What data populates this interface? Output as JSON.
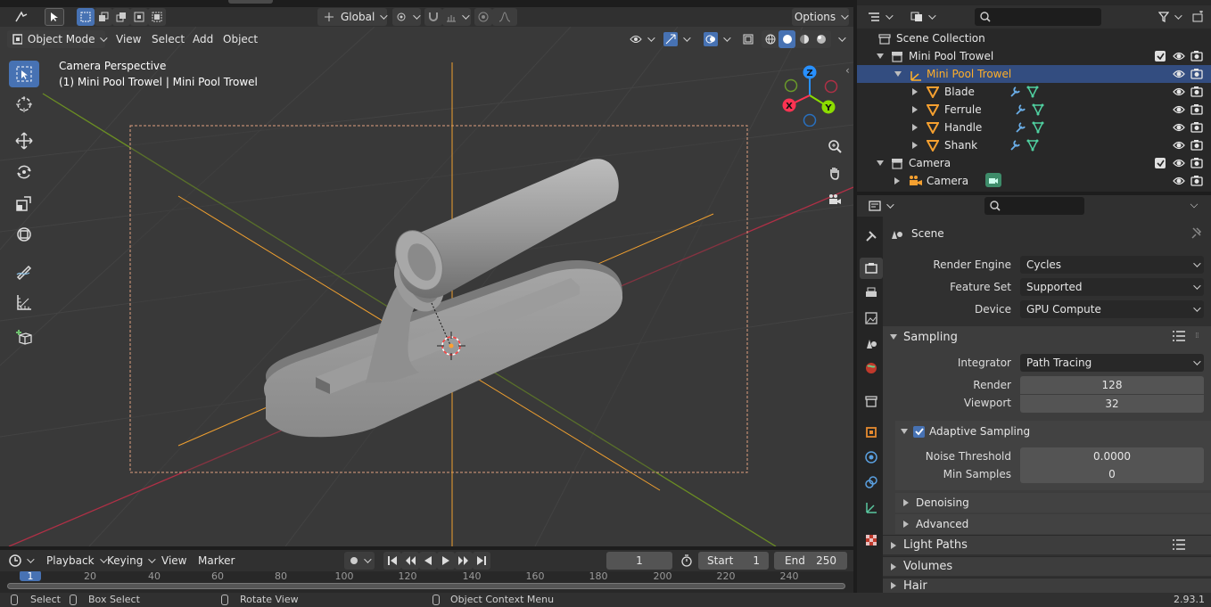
{
  "topbar": {
    "transform_orientation": "Global",
    "options_label": "Options"
  },
  "viewport_header": {
    "mode": "Object Mode",
    "menus": [
      "View",
      "Select",
      "Add",
      "Object"
    ]
  },
  "viewport": {
    "overlay_title": "Camera Perspective",
    "overlay_subtitle": "(1) Mini Pool Trowel | Mini Pool Trowel",
    "gizmo": {
      "z": "Z",
      "y": "Y",
      "x": "X"
    }
  },
  "outliner": {
    "root": "Scene Collection",
    "rows": [
      {
        "label": "Mini Pool Trowel",
        "type": "collection"
      },
      {
        "label": "Mini Pool Trowel",
        "type": "empty",
        "selected": true
      },
      {
        "label": "Blade",
        "type": "mesh"
      },
      {
        "label": "Ferrule",
        "type": "mesh"
      },
      {
        "label": "Handle",
        "type": "mesh"
      },
      {
        "label": "Shank",
        "type": "mesh"
      },
      {
        "label": "Camera",
        "type": "collection"
      },
      {
        "label": "Camera",
        "type": "camera"
      }
    ]
  },
  "properties": {
    "context": "Scene",
    "render_engine_label": "Render Engine",
    "render_engine": "Cycles",
    "feature_set_label": "Feature Set",
    "feature_set": "Supported",
    "device_label": "Device",
    "device": "GPU Compute",
    "sampling": {
      "title": "Sampling",
      "integrator_label": "Integrator",
      "integrator": "Path Tracing",
      "render_label": "Render",
      "render": "128",
      "viewport_label": "Viewport",
      "viewport": "32",
      "adaptive_title": "Adaptive Sampling",
      "noise_threshold_label": "Noise Threshold",
      "noise_threshold": "0.0000",
      "min_samples_label": "Min Samples",
      "min_samples": "0",
      "denoising": "Denoising",
      "advanced": "Advanced"
    },
    "panels": [
      "Light Paths",
      "Volumes",
      "Hair"
    ]
  },
  "timeline": {
    "menus": [
      "Playback",
      "Keying",
      "View",
      "Marker"
    ],
    "current_frame": "1",
    "start_label": "Start",
    "start": "1",
    "end_label": "End",
    "end": "250",
    "ruler": [
      "1",
      "20",
      "40",
      "60",
      "80",
      "100",
      "120",
      "140",
      "160",
      "180",
      "200",
      "220",
      "240"
    ]
  },
  "statusbar": {
    "select": "Select",
    "box_select": "Box Select",
    "rotate_view": "Rotate View",
    "context_menu": "Object Context Menu",
    "version": "2.93.1"
  },
  "colors": {
    "accent": "#4772b3",
    "selected_text": "#ffaf29",
    "x_axis": "#ff3352",
    "y_axis": "#8bdc00",
    "z_axis": "#2890ff"
  }
}
